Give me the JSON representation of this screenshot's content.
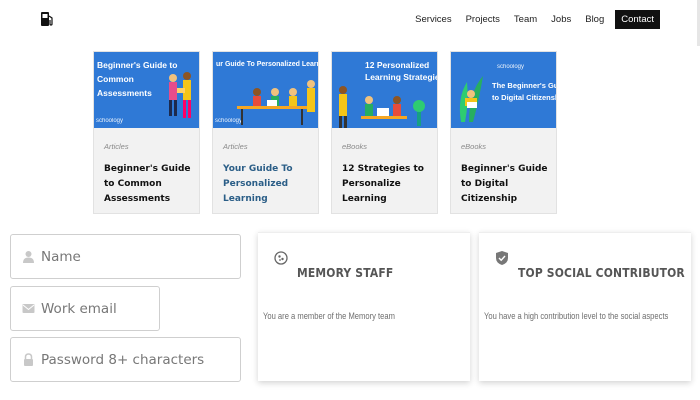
{
  "header": {
    "logo_icon": "gas-pump-icon",
    "nav": {
      "services": "Services",
      "projects": "Projects",
      "team": "Team",
      "jobs": "Jobs",
      "blog": "Blog",
      "contact": "Contact"
    }
  },
  "cards": [
    {
      "image_title_line1": "Beginner's Guide to",
      "image_title_line2": "Common",
      "image_title_line3": "Assessments",
      "image_brand": "schoology",
      "category": "Articles",
      "title": "Beginner's Guide to Common Assessments"
    },
    {
      "image_title_line1": "ur Guide To Personalized Learning",
      "image_brand": "schoology",
      "category": "Articles",
      "title": "Your Guide To Personalized Learning"
    },
    {
      "image_title_line1": "12 Personalized",
      "image_title_line2": "Learning Strategies",
      "category": "eBooks",
      "title": "12 Strategies to Personalize Learning"
    },
    {
      "image_brand": "schoology",
      "image_title_line1": "The Beginner's Guide",
      "image_title_line2": "to Digital Citizenship",
      "category": "eBooks",
      "title": "Beginner's Guide to Digital Citizenship"
    }
  ],
  "form": {
    "name_placeholder": "Name",
    "email_placeholder": "Work email",
    "password_placeholder": "Password 8+ characters"
  },
  "badges": [
    {
      "icon": "memory-badge-icon",
      "title": "MEMORY STAFF",
      "description": "You are a member of the Memory team"
    },
    {
      "icon": "shield-check-icon",
      "title": "TOP SOCIAL CONTRIBUTOR",
      "description": "You have a high contribution level to the social aspects"
    }
  ],
  "colors": {
    "card_image_blue": "#2f79d6",
    "contact_bg": "#111111",
    "link_blue": "#2b5e87"
  }
}
